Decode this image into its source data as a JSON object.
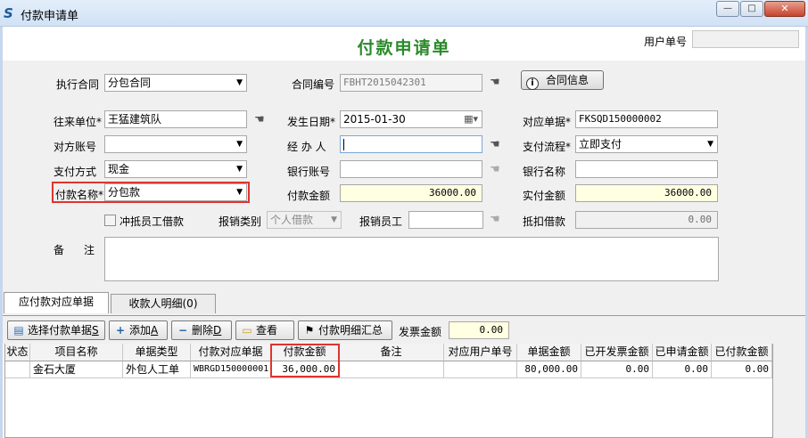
{
  "window": {
    "title": "付款申请单",
    "min_glyph": "—",
    "max_glyph": "□",
    "close_glyph": "✕"
  },
  "header": {
    "title": "付款申请单",
    "user_no_label": "用户单号",
    "user_no_value": ""
  },
  "contract": {
    "label": "执行合同",
    "value": "分包合同",
    "code_label": "合同编号",
    "code_value": "FBHT2015042301",
    "info_button": "合同信息"
  },
  "form": {
    "partner_label": "往来单位*",
    "partner_value": "王猛建筑队",
    "date_label": "发生日期*",
    "date_value": "2015-01-30",
    "ref_doc_label": "对应单据*",
    "ref_doc_value": "FKSQD150000002",
    "account_label": "对方账号",
    "account_value": "",
    "handler_label": "经 办 人",
    "handler_value": "",
    "flow_label": "支付流程*",
    "flow_value": "立即支付",
    "pay_method_label": "支付方式",
    "pay_method_value": "现金",
    "bank_account_label": "银行账号",
    "bank_account_value": "",
    "bank_name_label": "银行名称",
    "bank_name_value": "",
    "pay_name_label": "付款名称*",
    "pay_name_value": "分包款",
    "pay_amount_label": "付款金额",
    "pay_amount_value": "36000.00",
    "actual_amount_label": "实付金额",
    "actual_amount_value": "36000.00",
    "offset_loan_label": "冲抵员工借款",
    "offset_loan_checked": false,
    "reimb_type_label": "报销类别",
    "reimb_type_value": "个人借款",
    "reimb_staff_label": "报销员工",
    "reimb_staff_value": "",
    "deduct_loan_label": "抵扣借款",
    "deduct_loan_value": "0.00",
    "remark_label_1": "备",
    "remark_label_2": "注",
    "remark_value": ""
  },
  "tabs": [
    {
      "label": "应付款对应单据",
      "active": true
    },
    {
      "label": "收款人明细(0)",
      "active": false
    }
  ],
  "toolbar": {
    "select_button": "选择付款单据",
    "select_shortcut": "S",
    "add_button": "添加",
    "add_shortcut": "A",
    "delete_button": "删除",
    "delete_shortcut": "D",
    "view_button": "查看",
    "summary_button": "付款明细汇总",
    "invoice_label": "发票金额",
    "invoice_value": "0.00"
  },
  "grid": {
    "columns": [
      "状态",
      "项目名称",
      "单据类型",
      "付款对应单据",
      "付款金额",
      "备注",
      "对应用户单号",
      "单据金额",
      "已开发票金额",
      "已申请金额",
      "已付款金额"
    ],
    "rows": [
      [
        "",
        "金石大厦",
        "外包人工单",
        "WBRGD150000001",
        "36,000.00",
        "",
        "",
        "80,000.00",
        "0.00",
        "0.00",
        "0.00"
      ]
    ]
  },
  "colors": {
    "title_green": "#2b8a2b",
    "highlight_red": "#e0342f",
    "amount_yellow": "#ffffe1"
  }
}
